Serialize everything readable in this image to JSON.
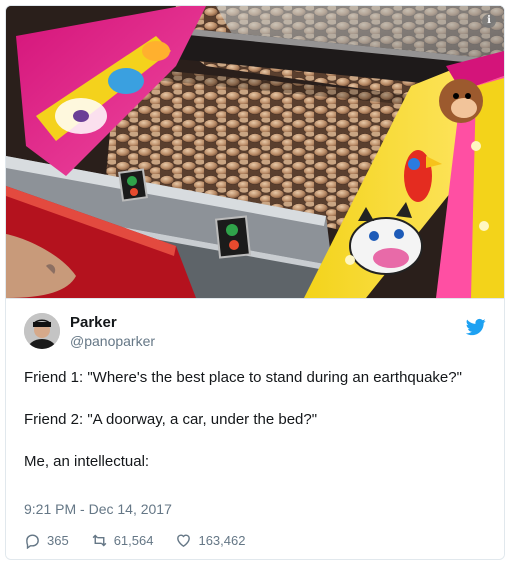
{
  "tweet": {
    "author": {
      "name": "Parker",
      "handle": "@panoparker"
    },
    "text": "Friend 1: \"Where's the best place to stand during an earthquake?\"\n\nFriend 2: \"A doorway, a car, under the bed?\"\n\nMe, an intellectual:",
    "timestamp": "9:21 PM - Dec 14, 2017",
    "stats": {
      "replies": "365",
      "retweets": "61,564",
      "likes": "163,462"
    }
  },
  "icons": {
    "info": "info-icon",
    "bird": "twitter-bird-icon",
    "reply": "reply-icon",
    "retweet": "retweet-icon",
    "like": "heart-icon"
  },
  "colors": {
    "twitter_blue": "#1da1f2",
    "secondary_text": "#657786",
    "primary_text": "#14171a",
    "border": "#e1e8ed"
  }
}
